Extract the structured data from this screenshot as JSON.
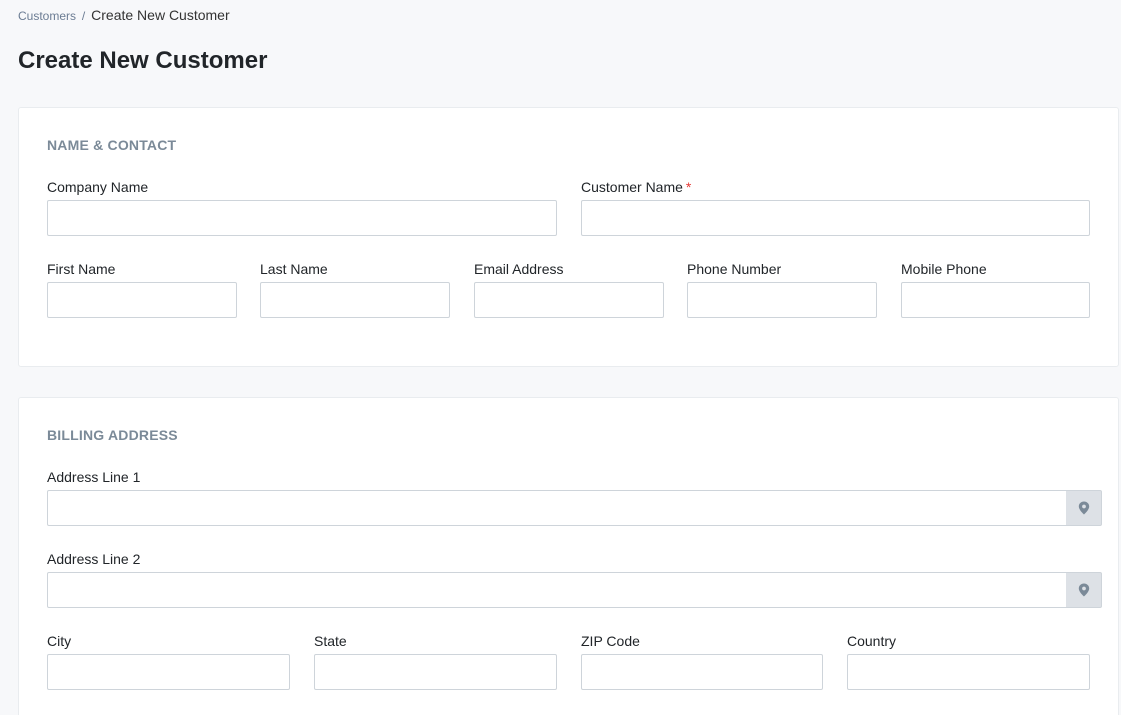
{
  "breadcrumb": {
    "parent": "Customers",
    "separator": "/",
    "current": "Create New Customer"
  },
  "page_title": "Create New Customer",
  "sections": {
    "name_contact": {
      "title": "NAME & CONTACT",
      "company_name": {
        "label": "Company Name",
        "value": "",
        "placeholder": ""
      },
      "customer_name": {
        "label": "Customer Name",
        "required_mark": "*",
        "value": "",
        "placeholder": ""
      },
      "first_name": {
        "label": "First Name",
        "value": "",
        "placeholder": ""
      },
      "last_name": {
        "label": "Last Name",
        "value": "",
        "placeholder": ""
      },
      "email_address": {
        "label": "Email Address",
        "value": "",
        "placeholder": ""
      },
      "phone_number": {
        "label": "Phone Number",
        "value": "",
        "placeholder": ""
      },
      "mobile_phone": {
        "label": "Mobile Phone",
        "value": "",
        "placeholder": ""
      }
    },
    "billing_address": {
      "title": "BILLING ADDRESS",
      "address_line_1": {
        "label": "Address Line 1",
        "value": "",
        "placeholder": "",
        "addon_icon": "map-pin-icon"
      },
      "address_line_2": {
        "label": "Address Line 2",
        "value": "",
        "placeholder": "",
        "addon_icon": "map-pin-icon"
      },
      "city": {
        "label": "City",
        "value": "",
        "placeholder": ""
      },
      "state": {
        "label": "State",
        "value": "",
        "placeholder": ""
      },
      "zip_code": {
        "label": "ZIP Code",
        "value": "",
        "placeholder": ""
      },
      "country": {
        "label": "Country",
        "value": "",
        "placeholder": ""
      }
    }
  },
  "colors": {
    "page_background": "#f7f8fa",
    "card_background": "#ffffff",
    "section_title": "#7b8a98",
    "required": "#e53935",
    "addon_background": "#dde1e6",
    "addon_icon": "#7b8a98",
    "input_border": "#ced4da"
  }
}
